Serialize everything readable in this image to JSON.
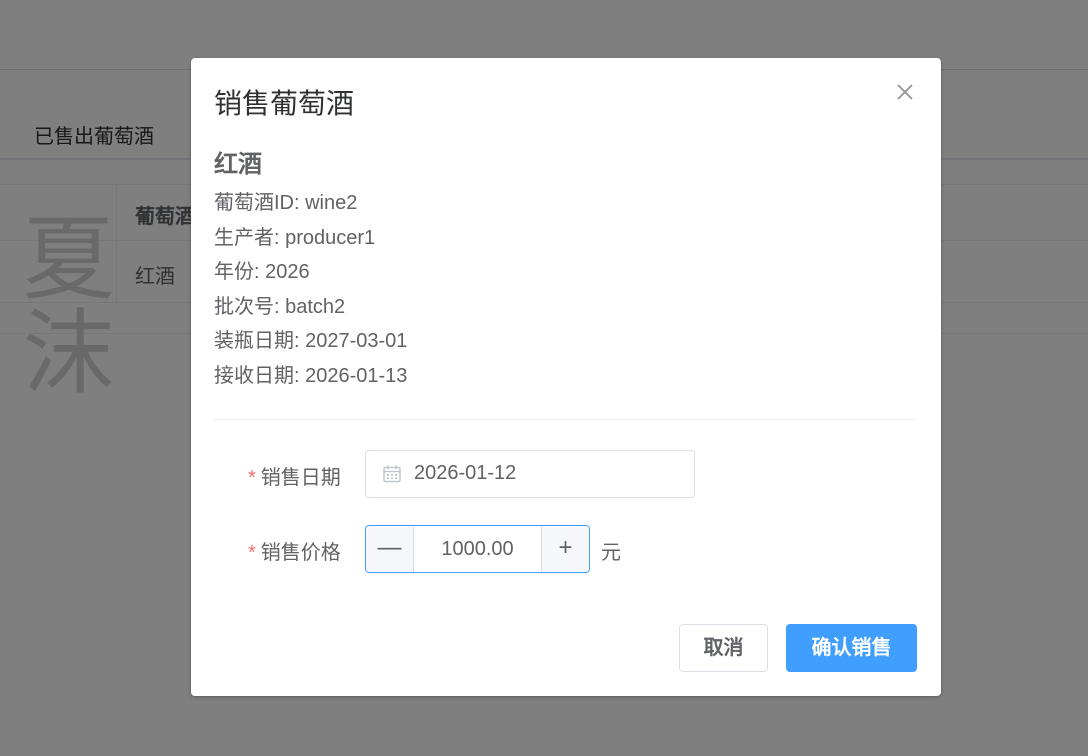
{
  "background": {
    "tab_label": "已售出葡萄酒",
    "table_header": "葡萄酒",
    "table_cell": "红酒",
    "watermark": "夏沫mds"
  },
  "dialog": {
    "title": "销售葡萄酒",
    "close_icon": "close-icon",
    "wine_name": "红酒",
    "info": [
      "葡萄酒ID: wine2",
      "生产者: producer1",
      "年份: 2026",
      "批次号: batch2",
      "装瓶日期: 2027-03-01",
      "接收日期: 2026-01-13"
    ],
    "form": {
      "required_mark": "*",
      "date_label": "销售日期",
      "date_value": "2026-01-12",
      "date_icon": "calendar-icon",
      "price_label": "销售价格",
      "price_value": "1000.00",
      "minus_label": "—",
      "plus_label": "+",
      "unit": "元"
    },
    "buttons": {
      "cancel": "取消",
      "confirm": "确认销售"
    }
  },
  "colors": {
    "primary": "#409eff",
    "required": "#f56c6c",
    "overlay": "rgba(0,0,0,0.5)"
  }
}
